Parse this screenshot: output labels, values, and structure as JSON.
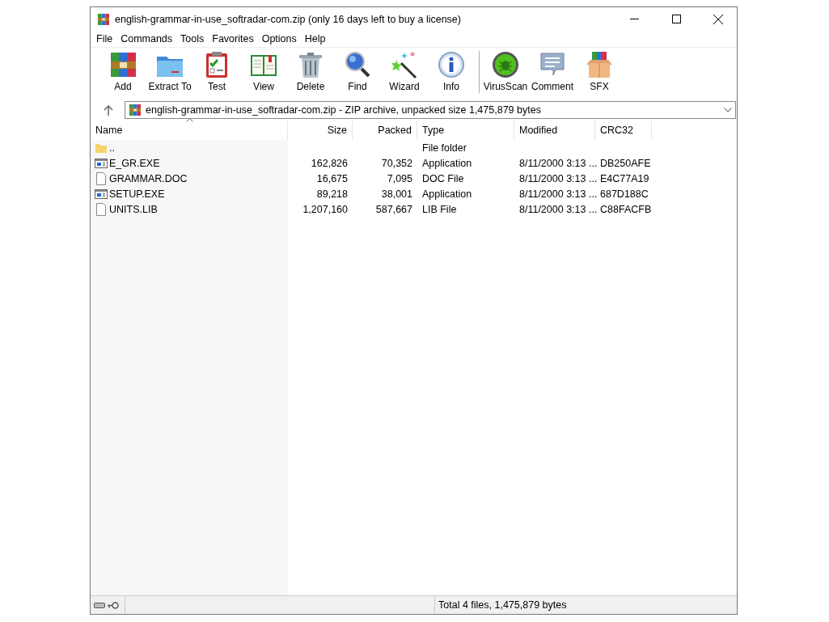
{
  "window": {
    "title": "english-grammar-in-use_softradar-com.zip (only 16 days left to buy a license)"
  },
  "menu": [
    "File",
    "Commands",
    "Tools",
    "Favorites",
    "Options",
    "Help"
  ],
  "toolbar": [
    {
      "kind": "add",
      "label": "Add"
    },
    {
      "kind": "extract",
      "label": "Extract To"
    },
    {
      "kind": "test",
      "label": "Test"
    },
    {
      "kind": "view",
      "label": "View"
    },
    {
      "kind": "delete",
      "label": "Delete"
    },
    {
      "kind": "find",
      "label": "Find"
    },
    {
      "kind": "wizard",
      "label": "Wizard"
    },
    {
      "kind": "info",
      "label": "Info"
    },
    {
      "kind": "separator"
    },
    {
      "kind": "virusscan",
      "label": "VirusScan"
    },
    {
      "kind": "comment",
      "label": "Comment"
    },
    {
      "kind": "sfx",
      "label": "SFX"
    }
  ],
  "address": {
    "value": "english-grammar-in-use_softradar-com.zip - ZIP archive, unpacked size 1,475,879 bytes"
  },
  "table": {
    "columns": [
      "Name",
      "Size",
      "Packed",
      "Type",
      "Modified",
      "CRC32"
    ],
    "rows": [
      {
        "kind": "folder",
        "name": "..",
        "size": "",
        "packed": "",
        "type": "File folder",
        "modified": "",
        "crc32": ""
      },
      {
        "kind": "app",
        "name": "E_GR.EXE",
        "size": "162,826",
        "packed": "70,352",
        "type": "Application",
        "modified": "8/11/2000 3:13 ...",
        "crc32": "DB250AFE"
      },
      {
        "kind": "file",
        "name": "GRAMMAR.DOC",
        "size": "16,675",
        "packed": "7,095",
        "type": "DOC File",
        "modified": "8/11/2000 3:13 ...",
        "crc32": "E4C77A19"
      },
      {
        "kind": "app",
        "name": "SETUP.EXE",
        "size": "89,218",
        "packed": "38,001",
        "type": "Application",
        "modified": "8/11/2000 3:13 ...",
        "crc32": "687D188C"
      },
      {
        "kind": "file",
        "name": "UNITS.LIB",
        "size": "1,207,160",
        "packed": "587,667",
        "type": "LIB File",
        "modified": "8/11/2000 3:13 ...",
        "crc32": "C88FACFB"
      }
    ]
  },
  "status_bar": {
    "text": "Total 4 files, 1,475,879 bytes"
  }
}
